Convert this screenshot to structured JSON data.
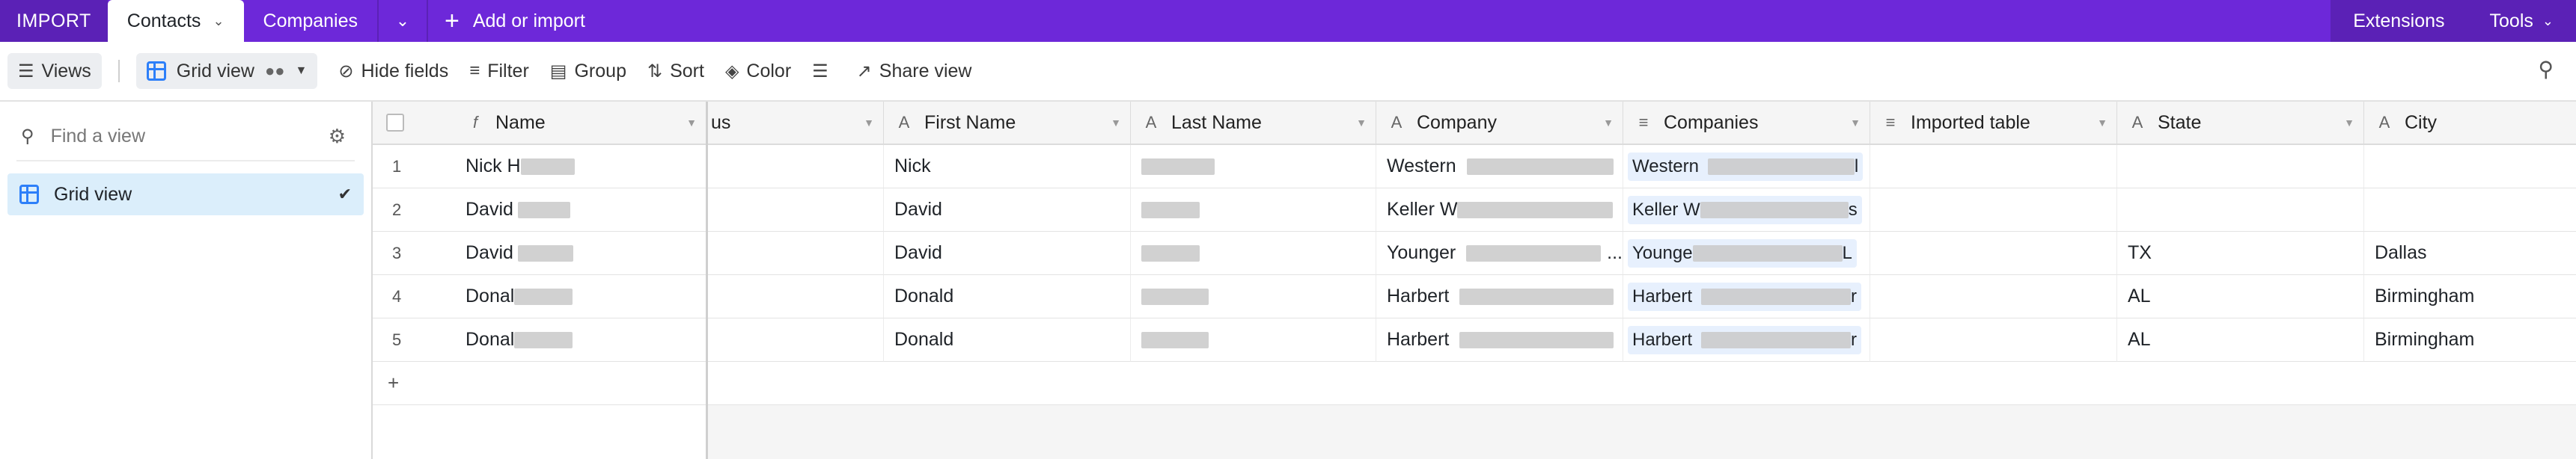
{
  "topbar": {
    "base_label": "IMPORT",
    "tabs": [
      {
        "label": "Contacts",
        "active": true
      },
      {
        "label": "Companies",
        "active": false
      }
    ],
    "add_label": "Add or import",
    "right": {
      "extensions": "Extensions",
      "tools": "Tools"
    }
  },
  "toolbar": {
    "views": "Views",
    "grid_view": "Grid view",
    "hide_fields": "Hide fields",
    "filter": "Filter",
    "group": "Group",
    "sort": "Sort",
    "color": "Color",
    "share_view": "Share view"
  },
  "sidebar": {
    "search_placeholder": "Find a view",
    "views": [
      {
        "label": "Grid view",
        "selected": true
      }
    ]
  },
  "grid": {
    "columns": {
      "name": "Name",
      "status_partial": "us",
      "first_name": "First Name",
      "last_name": "Last Name",
      "company": "Company",
      "companies": "Companies",
      "imported_table": "Imported table",
      "state": "State",
      "city": "City"
    },
    "rows": [
      {
        "num": "1",
        "name": "Nick H",
        "first_name": "Nick",
        "company": "Western",
        "companies": "Western",
        "companies_tail": "l",
        "state": "",
        "city": ""
      },
      {
        "num": "2",
        "name": "David",
        "first_name": "David",
        "company": "Keller W",
        "companies": "Keller W",
        "companies_tail": "s",
        "state": "",
        "city": ""
      },
      {
        "num": "3",
        "name": "David",
        "first_name": "David",
        "company": "Younger",
        "company_tail": "...",
        "companies": "Younge",
        "companies_tail": "L",
        "state": "TX",
        "city": "Dallas"
      },
      {
        "num": "4",
        "name": "Donal",
        "first_name": "Donald",
        "company": "Harbert",
        "companies": "Harbert",
        "companies_tail": "r",
        "state": "AL",
        "city": "Birmingham"
      },
      {
        "num": "5",
        "name": "Donal",
        "first_name": "Donald",
        "company": "Harbert",
        "companies": "Harbert",
        "companies_tail": "r",
        "state": "AL",
        "city": "Birmingham"
      }
    ],
    "add_row_label": "+"
  },
  "colors": {
    "brand": "#6d28d9",
    "view_selected": "#dbeefb",
    "grid_icon": "#2d7ff9"
  }
}
